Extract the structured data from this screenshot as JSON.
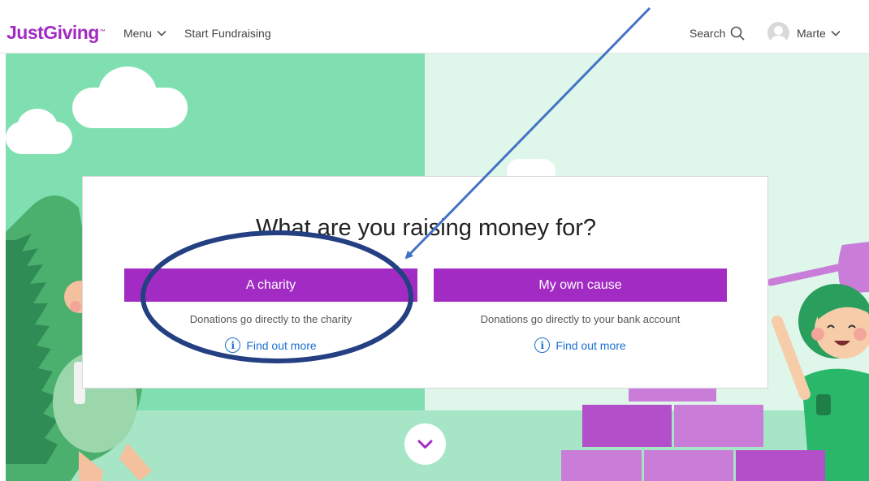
{
  "header": {
    "logo": "JustGiving",
    "logo_tm": "™",
    "menu_label": "Menu",
    "start_label": "Start Fundraising",
    "search_label": "Search",
    "user_name": "Marte"
  },
  "card": {
    "title": "What are you raising money for?",
    "options": [
      {
        "button_label": "A charity",
        "description": "Donations go directly to the charity",
        "link_label": "Find out more"
      },
      {
        "button_label": "My own cause",
        "description": "Donations go directly to your bank account",
        "link_label": "Find out more"
      }
    ]
  },
  "colors": {
    "brand": "#a22bc3",
    "link": "#1a6fcf",
    "hero_left": "#7fdfb1",
    "hero_right": "#dff6ea",
    "annotation": "#243f82",
    "arrow": "#4472c4"
  },
  "icons": {
    "menu_chevron": "chevron-down-icon",
    "search": "search-icon",
    "avatar": "avatar-icon",
    "info": "info-icon",
    "scroll": "chevron-down-icon"
  }
}
